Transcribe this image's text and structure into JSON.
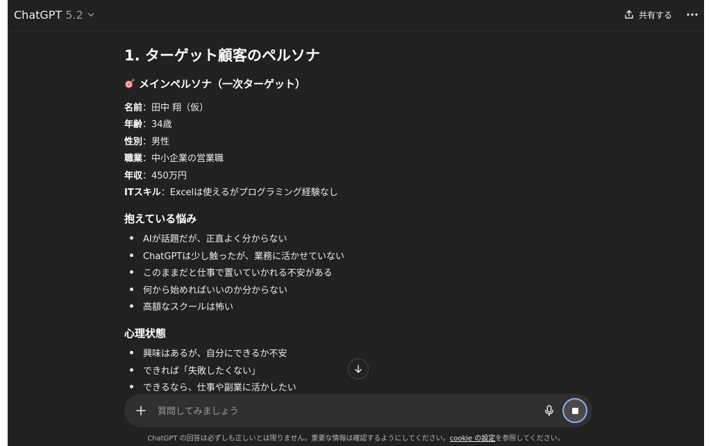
{
  "header": {
    "model_name": "ChatGPT",
    "model_version": "5.2",
    "share_label": "共有する"
  },
  "content": {
    "heading": "1. ターゲット顧客のペルソナ",
    "persona_heading": "メインペルソナ（一次ターゲット）",
    "profile": [
      {
        "key": "名前",
        "value": "：田中 翔（仮）"
      },
      {
        "key": "年齢",
        "value": "：34歳"
      },
      {
        "key": "性別",
        "value": "：男性"
      },
      {
        "key": "職業",
        "value": "：中小企業の営業職"
      },
      {
        "key": "年収",
        "value": "：450万円"
      },
      {
        "key": "ITスキル",
        "value": "：Excelは使えるがプログラミング経験なし"
      }
    ],
    "worries_heading": "抱えている悩み",
    "worries": [
      "AIが話題だが、正直よく分からない",
      "ChatGPTは少し触ったが、業務に活かせていない",
      "このままだと仕事で置いていかれる不安がある",
      "何から始めればいいのか分からない",
      "高額なスクールは怖い"
    ],
    "mind_heading": "心理状態",
    "mind": [
      "興味はあるが、自分にできるか不安",
      "できれば「失敗したくない」",
      "できるなら、仕事や副業に活かしたい"
    ]
  },
  "composer": {
    "placeholder": "質問してみましょう"
  },
  "footer": {
    "disclaimer_pre": "ChatGPT の回答は必ずしも正しいとは限りません。重要な情報は確認するようにしてください。",
    "cookie_link": "cookie の設定",
    "disclaimer_post": "を参照してください。"
  }
}
